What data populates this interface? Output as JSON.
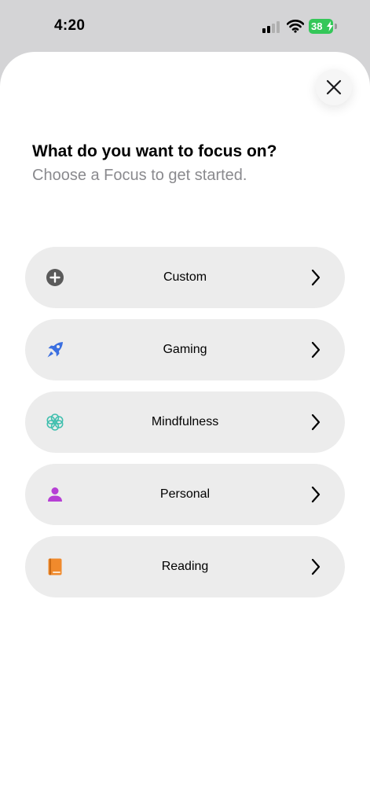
{
  "status": {
    "time": "4:20",
    "battery": "38"
  },
  "sheet": {
    "title": "What do you want to focus on?",
    "subtitle": "Choose a Focus to get started."
  },
  "options": [
    {
      "label": "Custom",
      "icon": "plus-circle-icon",
      "color": "#5a5a5a"
    },
    {
      "label": "Gaming",
      "icon": "rocket-icon",
      "color": "#3b6fe0"
    },
    {
      "label": "Mindfulness",
      "icon": "flower-icon",
      "color": "#3fbfae"
    },
    {
      "label": "Personal",
      "icon": "person-icon",
      "color": "#b63fd4"
    },
    {
      "label": "Reading",
      "icon": "book-icon",
      "color": "#f08a2c"
    }
  ]
}
